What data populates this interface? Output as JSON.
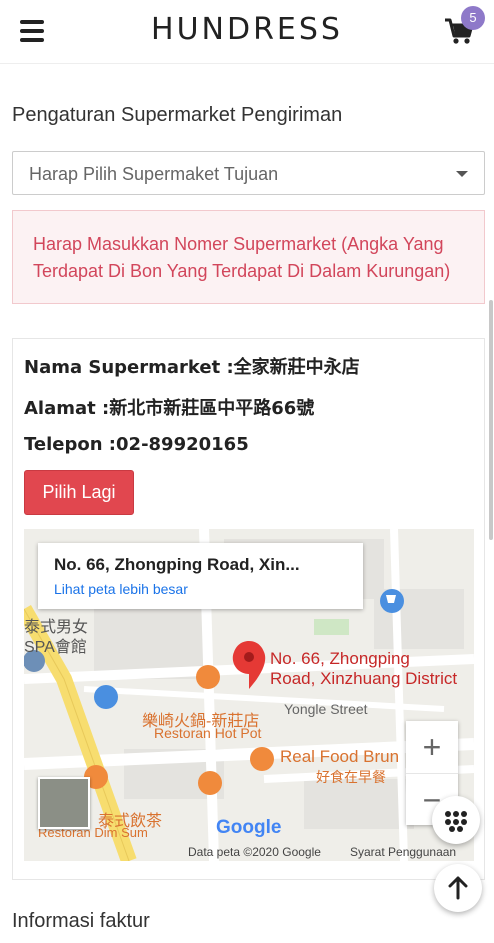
{
  "header": {
    "logo": "HUNDRESS",
    "cart_count": "5"
  },
  "shipping": {
    "title": "Pengaturan Supermarket Pengiriman",
    "select_placeholder": "Harap Pilih Supermaket Tujuan",
    "alert": "Harap Masukkan Nomer Supermarket (Angka Yang Terdapat Di Bon Yang Terdapat Di Dalam Kurungan)",
    "store_name_label": "Nama Supermarket :",
    "store_name": "全家新莊中永店",
    "address_label": "Alamat :",
    "address": "新北市新莊區中平路66號",
    "phone_label": "Telepon :",
    "phone": "02-89920165",
    "choose_again": "Pilih Lagi"
  },
  "map": {
    "popup_title": "No. 66, Zhongping Road, Xin...",
    "popup_link": "Lihat peta lebih besar",
    "marker_label_line1": "No. 66, Zhongping",
    "marker_label_line2": "Road, Xinzhuang District",
    "place_cn_1": "泰式男女",
    "place_cn_2": "SPA會館",
    "place_restaurant_cn": "樂崎火鍋-新莊店",
    "place_restaurant_en": "Restoran Hot Pot",
    "street": "Yongle Street",
    "place_food": "Real Food Brun",
    "place_food_cn": "好食在早餐",
    "place_dimsum_cn": "泰式飲茶",
    "place_dimsum_en": "Restoran Dim Sum",
    "zoom_in": "+",
    "zoom_out": "−",
    "google": "Google",
    "data_credit": "Data peta ©2020 Google",
    "terms": "Syarat Penggunaan",
    "colors": {
      "marker": "#e53935",
      "poi_orange": "#f08a3c",
      "poi_blue": "#4a8fe0",
      "road_yellow": "#f7dd6f"
    }
  },
  "invoice": {
    "title": "Informasi faktur"
  }
}
